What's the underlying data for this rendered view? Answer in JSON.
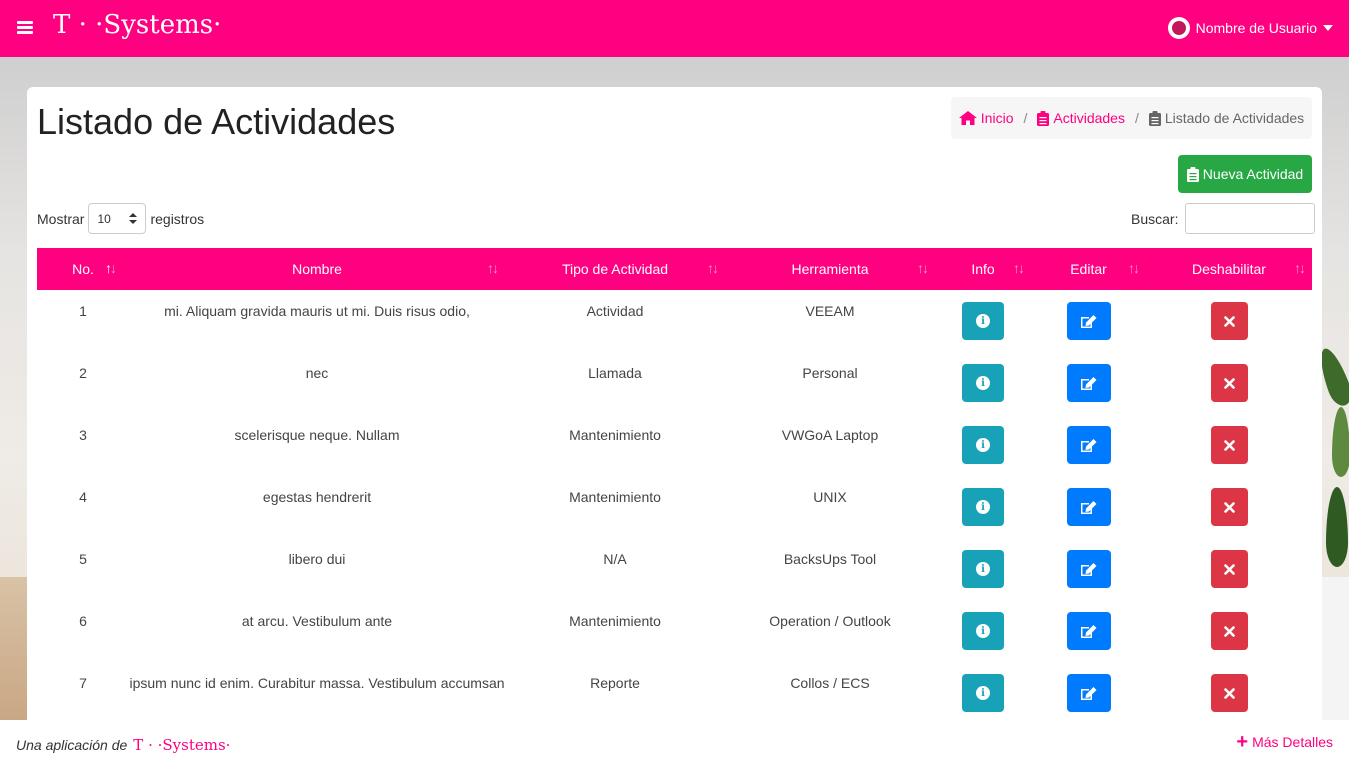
{
  "app": {
    "brand": "T · ·Systems·",
    "user_name": "Nombre de Usuario"
  },
  "page": {
    "title": "Listado de Actividades",
    "breadcrumb": [
      {
        "label": "Inicio",
        "icon": "home-icon"
      },
      {
        "label": "Actividades",
        "icon": "clipboard-icon"
      },
      {
        "label": "Listado de Actividades",
        "icon": "clipboard-list-icon"
      }
    ],
    "new_button": "Nueva Actividad"
  },
  "controls": {
    "show_label": "Mostrar",
    "page_size": "10",
    "records_label": "registros",
    "search_label": "Buscar:",
    "search_value": ""
  },
  "table": {
    "columns": [
      "No.",
      "Nombre",
      "Tipo de Actividad",
      "Herramienta",
      "Info",
      "Editar",
      "Deshabilitar"
    ],
    "rows": [
      {
        "no": "1",
        "nombre": "mi. Aliquam gravida mauris ut mi. Duis risus odio,",
        "tipo": "Actividad",
        "herramienta": "VEEAM"
      },
      {
        "no": "2",
        "nombre": "nec",
        "tipo": "Llamada",
        "herramienta": "Personal"
      },
      {
        "no": "3",
        "nombre": "scelerisque neque. Nullam",
        "tipo": "Mantenimiento",
        "herramienta": "VWGoA Laptop"
      },
      {
        "no": "4",
        "nombre": "egestas hendrerit",
        "tipo": "Mantenimiento",
        "herramienta": "UNIX"
      },
      {
        "no": "5",
        "nombre": "libero dui",
        "tipo": "N/A",
        "herramienta": "BacksUps Tool"
      },
      {
        "no": "6",
        "nombre": "at arcu. Vestibulum ante",
        "tipo": "Mantenimiento",
        "herramienta": "Operation / Outlook"
      },
      {
        "no": "7",
        "nombre": "ipsum nunc id enim. Curabitur massa. Vestibulum accumsan",
        "tipo": "Reporte",
        "herramienta": "Collos / ECS"
      }
    ]
  },
  "footer": {
    "made_by": "Una aplicación de",
    "brand": "T · ·Systems·",
    "more": "Más Detalles"
  },
  "colors": {
    "brand": "#ff0080",
    "success": "#28a745",
    "info": "#17a2b8",
    "primary": "#007bff",
    "danger": "#dc3545"
  }
}
